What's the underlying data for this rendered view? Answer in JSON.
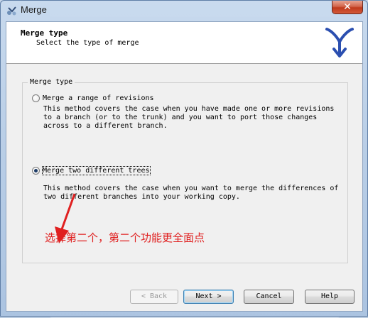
{
  "window": {
    "title": "Merge",
    "close_symbol": "✕"
  },
  "header": {
    "title": "Merge type",
    "subtitle": "Select the type of merge"
  },
  "group": {
    "legend": "Merge type"
  },
  "options": [
    {
      "label": "Merge a range of revisions",
      "description": "This method covers the case when you have made one or more revisions\nto a branch (or to the trunk) and you want to port those changes\nacross to a different branch.",
      "checked": false
    },
    {
      "label": "Merge two different trees",
      "description": "This method covers the case when you want to merge the differences of\ntwo different branches into your working copy.",
      "checked": true
    }
  ],
  "annotation": {
    "text": "选择第二个，第二个功能更全面点",
    "color": "#e02020"
  },
  "buttons": {
    "back": "< Back",
    "next": "Next >",
    "cancel": "Cancel",
    "help": "Help"
  },
  "colors": {
    "close": "#c0391c",
    "accent": "#3c7fb1",
    "logo": "#2b4fb0"
  }
}
